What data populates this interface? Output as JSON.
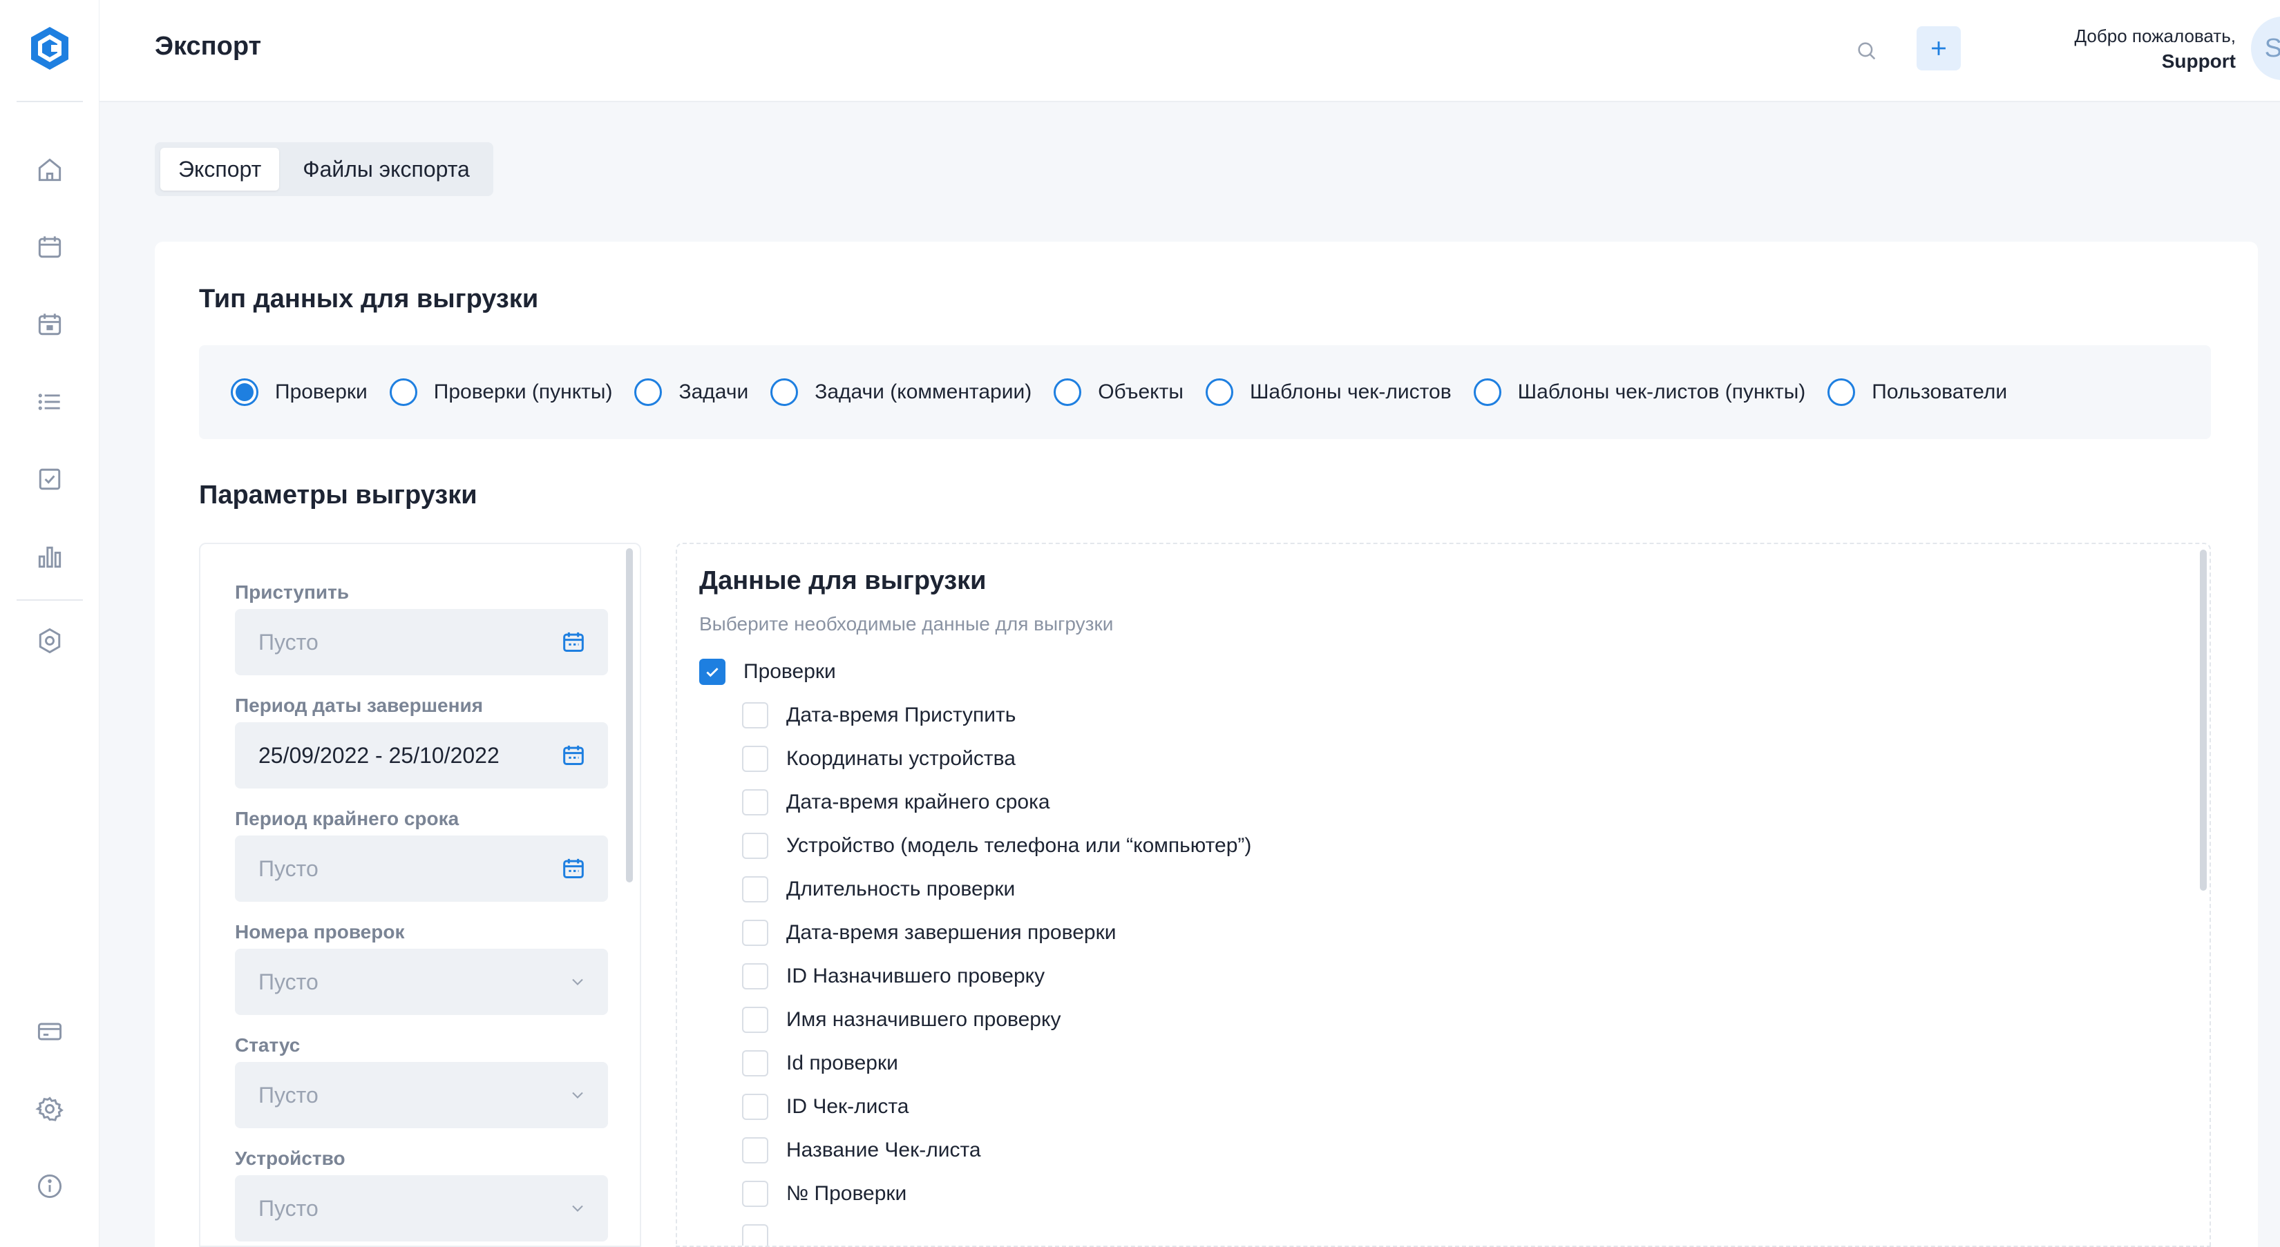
{
  "header": {
    "title": "Экспорт",
    "welcome": "Добро пожаловать,",
    "user_name": "Support",
    "avatar_initials": "SU"
  },
  "tabs": [
    {
      "label": "Экспорт",
      "active": true
    },
    {
      "label": "Файлы экспорта",
      "active": false
    }
  ],
  "data_type": {
    "title": "Тип данных для выгрузки",
    "options": [
      {
        "label": "Проверки",
        "checked": true
      },
      {
        "label": "Проверки (пункты)",
        "checked": false
      },
      {
        "label": "Задачи",
        "checked": false
      },
      {
        "label": "Задачи (комментарии)",
        "checked": false
      },
      {
        "label": "Объекты",
        "checked": false
      },
      {
        "label": "Шаблоны чек-листов",
        "checked": false
      },
      {
        "label": "Шаблоны чек-листов (пункты)",
        "checked": false
      },
      {
        "label": "Пользователи",
        "checked": false
      }
    ]
  },
  "params": {
    "title": "Параметры выгрузки",
    "filters": [
      {
        "label": "Приступить",
        "value": "Пусто",
        "filled": false,
        "control": "date"
      },
      {
        "label": "Период даты завершения",
        "value": "25/09/2022 - 25/10/2022",
        "filled": true,
        "control": "date"
      },
      {
        "label": "Период крайнего срока",
        "value": "Пусто",
        "filled": false,
        "control": "date"
      },
      {
        "label": "Номера проверок",
        "value": "Пусто",
        "filled": false,
        "control": "select"
      },
      {
        "label": "Статус",
        "value": "Пусто",
        "filled": false,
        "control": "select"
      },
      {
        "label": "Устройство",
        "value": "Пусто",
        "filled": false,
        "control": "select"
      }
    ]
  },
  "data_fields": {
    "title": "Данные для выгрузки",
    "subtitle": "Выберите необходимые данные для выгрузки",
    "parent": {
      "label": "Проверки",
      "checked": true
    },
    "items": [
      {
        "label": "Дата-время Приступить",
        "checked": false
      },
      {
        "label": "Координаты устройства",
        "checked": false
      },
      {
        "label": "Дата-время крайнего срока",
        "checked": false
      },
      {
        "label": "Устройство (модель телефона или “компьютер”)",
        "checked": false
      },
      {
        "label": "Длительность проверки",
        "checked": false
      },
      {
        "label": "Дата-время завершения проверки",
        "checked": false
      },
      {
        "label": "ID Назначившего проверку",
        "checked": false
      },
      {
        "label": "Имя назначившего проверку",
        "checked": false
      },
      {
        "label": "Id проверки",
        "checked": false
      },
      {
        "label": "ID Чек-листа",
        "checked": false
      },
      {
        "label": "Название Чек-листа",
        "checked": false
      },
      {
        "label": "№ Проверки",
        "checked": false
      }
    ]
  },
  "colors": {
    "accent": "#1e7fe0",
    "sidebar_icon": "#8a95a8"
  }
}
